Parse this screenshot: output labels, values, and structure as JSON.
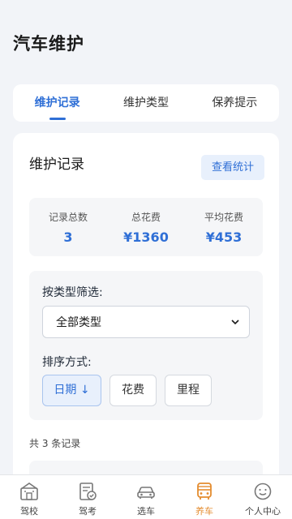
{
  "page": {
    "title": "汽车维护"
  },
  "tabs": [
    {
      "label": "维护记录",
      "active": true
    },
    {
      "label": "维护类型",
      "active": false
    },
    {
      "label": "保养提示",
      "active": false
    }
  ],
  "card": {
    "title": "维护记录",
    "stats_button": "查看统计",
    "summary": [
      {
        "label": "记录总数",
        "value": "3"
      },
      {
        "label": "总花费",
        "value": "¥1360"
      },
      {
        "label": "平均花费",
        "value": "¥453"
      }
    ],
    "filter": {
      "type_label": "按类型筛选:",
      "type_selected": "全部类型",
      "sort_label": "排序方式:",
      "sort_options": [
        "日期 ↓",
        "花费",
        "里程"
      ]
    },
    "count_text": "共 3 条记录"
  },
  "bottom_nav": [
    {
      "label": "驾校",
      "icon": "school-icon",
      "active": false
    },
    {
      "label": "驾考",
      "icon": "exam-icon",
      "active": false
    },
    {
      "label": "选车",
      "icon": "car-icon",
      "active": false
    },
    {
      "label": "养车",
      "icon": "bus-icon",
      "active": true
    },
    {
      "label": "个人中心",
      "icon": "smile-icon",
      "active": false
    }
  ],
  "colors": {
    "accent": "#2f6fd6",
    "nav_active": "#e48c2f",
    "background": "#f2f4f8"
  }
}
